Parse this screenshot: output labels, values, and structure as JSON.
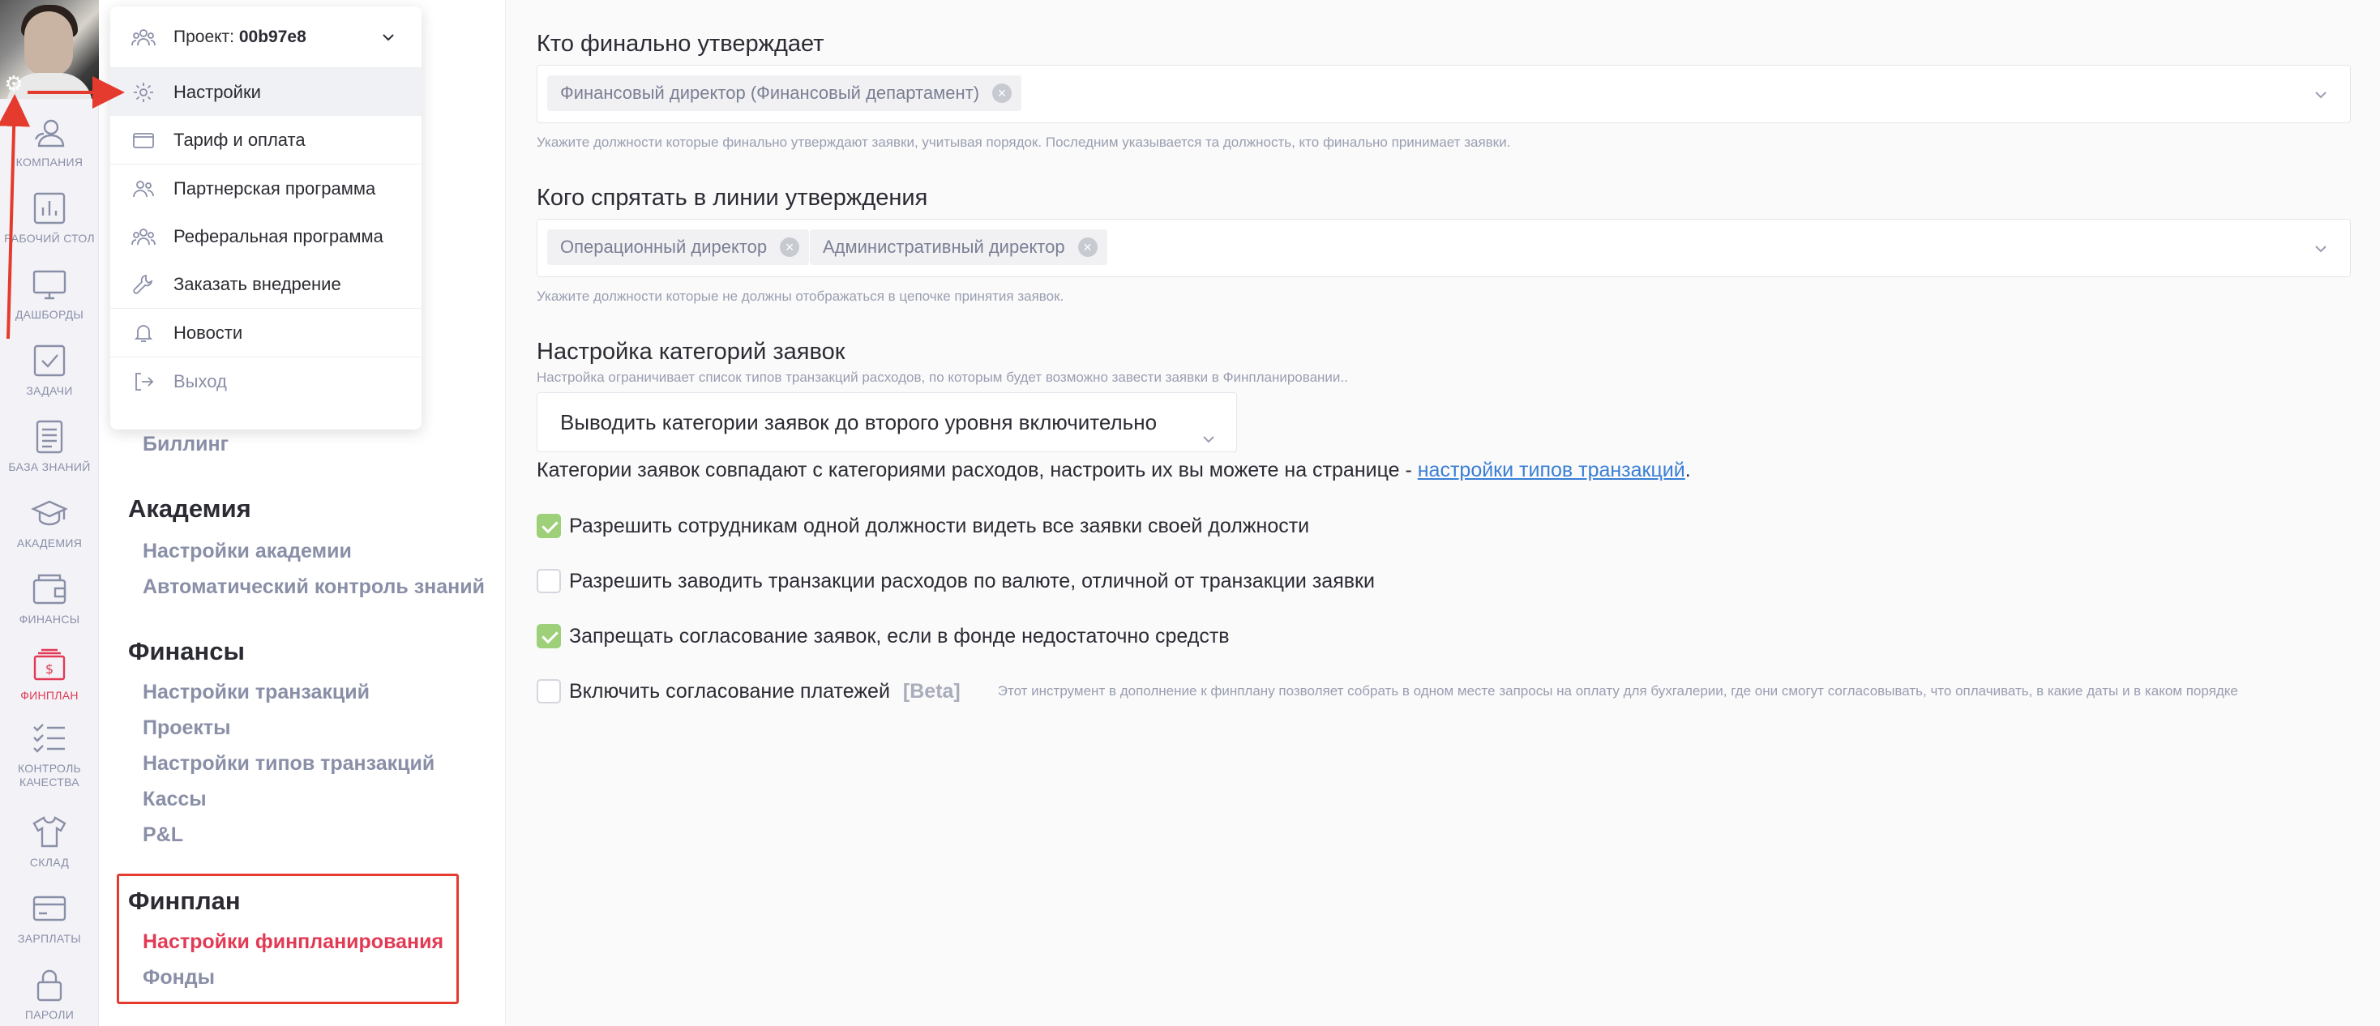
{
  "colors": {
    "accent": "#e23a55",
    "annotation": "#e43b2e",
    "check": "#9ed07a",
    "link": "#3a7fd5"
  },
  "rail": {
    "items": [
      {
        "label": "КОМПАНИЯ",
        "icon": "company-icon"
      },
      {
        "label": "РАБОЧИЙ СТОЛ",
        "icon": "bar-chart-icon"
      },
      {
        "label": "ДАШБОРДЫ",
        "icon": "monitor-icon"
      },
      {
        "label": "ЗАДАЧИ",
        "icon": "checkbox-icon"
      },
      {
        "label": "БАЗА ЗНАНИЙ",
        "icon": "document-icon"
      },
      {
        "label": "АКАДЕМИЯ",
        "icon": "graduation-cap-icon"
      },
      {
        "label": "ФИНАНСЫ",
        "icon": "wallet-icon"
      },
      {
        "label": "ФИНПЛАН",
        "icon": "finplan-icon"
      },
      {
        "label": "КОНТРОЛЬ КАЧЕСТВА",
        "icon": "checklist-icon"
      },
      {
        "label": "СКЛАД",
        "icon": "tshirt-icon"
      },
      {
        "label": "ЗАРПЛАТЫ",
        "icon": "card-icon"
      },
      {
        "label": "ПАРОЛИ",
        "icon": "lock-icon"
      }
    ]
  },
  "menu": {
    "project_prefix": "Проект:",
    "project_id": "00b97e8",
    "items": [
      {
        "label": "Настройки",
        "icon": "gear-icon"
      },
      {
        "label": "Тариф и оплата",
        "icon": "wallet-icon"
      },
      {
        "label": "Партнерская программа",
        "icon": "users-icon"
      },
      {
        "label": "Реферальная программа",
        "icon": "group-icon"
      },
      {
        "label": "Заказать внедрение",
        "icon": "wrench-icon"
      },
      {
        "label": "Новости",
        "icon": "bell-icon"
      },
      {
        "label": "Выход",
        "icon": "logout-icon"
      }
    ]
  },
  "nav": {
    "billing": "Биллинг",
    "academy_title": "Академия",
    "academy_links": [
      "Настройки академии",
      "Автоматический контроль знаний"
    ],
    "finance_title": "Финансы",
    "finance_links": [
      "Настройки транзакций",
      "Проекты",
      "Настройки типов транзакций",
      "Кассы",
      "P&L"
    ],
    "finplan_title": "Финплан",
    "finplan_links": [
      "Настройки финпланирования",
      "Фонды"
    ]
  },
  "main": {
    "final_approver": {
      "title": "Кто финально утверждает",
      "tags": [
        "Финансовый директор (Финансовый департамент)"
      ],
      "hint": "Укажите должности которые финально утверждают заявки, учитывая порядок. Последним указывается та должность, кто финально принимает заявки."
    },
    "hide_in_line": {
      "title": "Кого спрятать в линии утверждения",
      "tags": [
        "Операционный директор",
        "Административный директор"
      ],
      "hint": "Укажите должности которые не должны отображаться в цепочке принятия заявок."
    },
    "categories": {
      "title": "Настройка категорий заявок",
      "hint": "Настройка ограничивает список типов транзакций расходов, по которым будет возможно завести заявки в Финпланировании..",
      "select_value": "Выводить категории заявок до второго уровня включительно",
      "note_text": "Категории заявок совпадают с категориями расходов, настроить их вы можете на странице - ",
      "note_link": "настройки типов транзакций",
      "note_end": "."
    },
    "checkboxes": [
      {
        "label": "Разрешить сотрудникам одной должности видеть все заявки своей должности",
        "checked": true
      },
      {
        "label": "Разрешить заводить транзакции расходов по валюте, отличной от транзакции заявки",
        "checked": false
      },
      {
        "label": "Запрещать согласование заявок, если в фонде недостаточно средств",
        "checked": true
      },
      {
        "label": "Включить согласование платежей",
        "checked": false,
        "badge": "[Beta]",
        "description": "Этот инструмент в дополнение к финплану позволяет собрать в одном месте запросы на оплату для бухгалерии, где они смогут согласовывать, что оплачивать, в какие даты и в каком порядке"
      }
    ]
  }
}
